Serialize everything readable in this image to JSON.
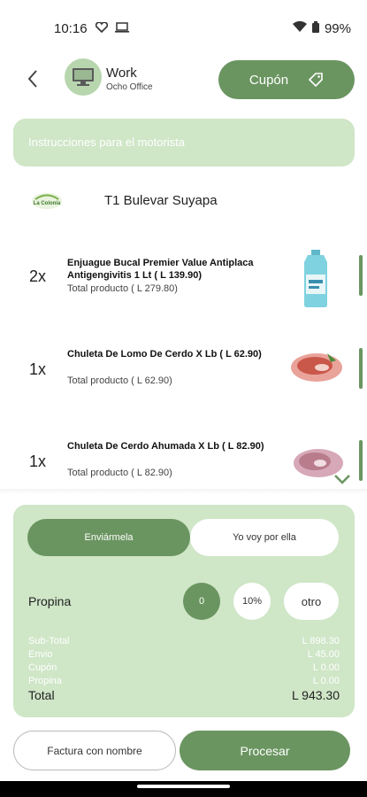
{
  "status": {
    "time": "10:16",
    "battery": "99%"
  },
  "header": {
    "address_title": "Work",
    "address_subtitle": "Ocho Office",
    "coupon_label": "Cupón"
  },
  "instructions": {
    "placeholder": "Instrucciones para el motorista"
  },
  "store": {
    "name": "T1 Bulevar Suyapa",
    "logo_text": "La Colonia"
  },
  "items": [
    {
      "qty": "2x",
      "name": "Enjuague Bucal Premier Value Antiplaca Antigengivitis 1 Lt  ( L 139.90)",
      "total": "Total producto  ( L 279.80)"
    },
    {
      "qty": "1x",
      "name": "Chuleta De Lomo De Cerdo X Lb  ( L 62.90)",
      "total": "Total producto  ( L 62.90)"
    },
    {
      "qty": "1x",
      "name": "Chuleta De Cerdo Ahumada X Lb  ( L 82.90)",
      "total": "Total producto  ( L 82.90)"
    }
  ],
  "delivery": {
    "option_send": "Enviármela",
    "option_pickup": "Yo voy por ella",
    "selected": "Enviármela"
  },
  "tip": {
    "label": "Propina",
    "options": [
      "0",
      "10%",
      "otro"
    ],
    "selected": "0"
  },
  "summary": {
    "subtotal_label": "Sub-Total",
    "subtotal_value": "L 898.30",
    "shipping_label": "Envio",
    "shipping_value": "L 45.00",
    "coupon_label": "Cupón",
    "coupon_value": "L 0.00",
    "tip_label": "Propina",
    "tip_value": "L 0.00",
    "total_label": "Total",
    "total_value": "L 943.30"
  },
  "actions": {
    "invoice_label": "Factura con nombre",
    "process_label": "Procesar"
  },
  "colors": {
    "primary": "#6a9560",
    "light": "#cfe6c7"
  }
}
